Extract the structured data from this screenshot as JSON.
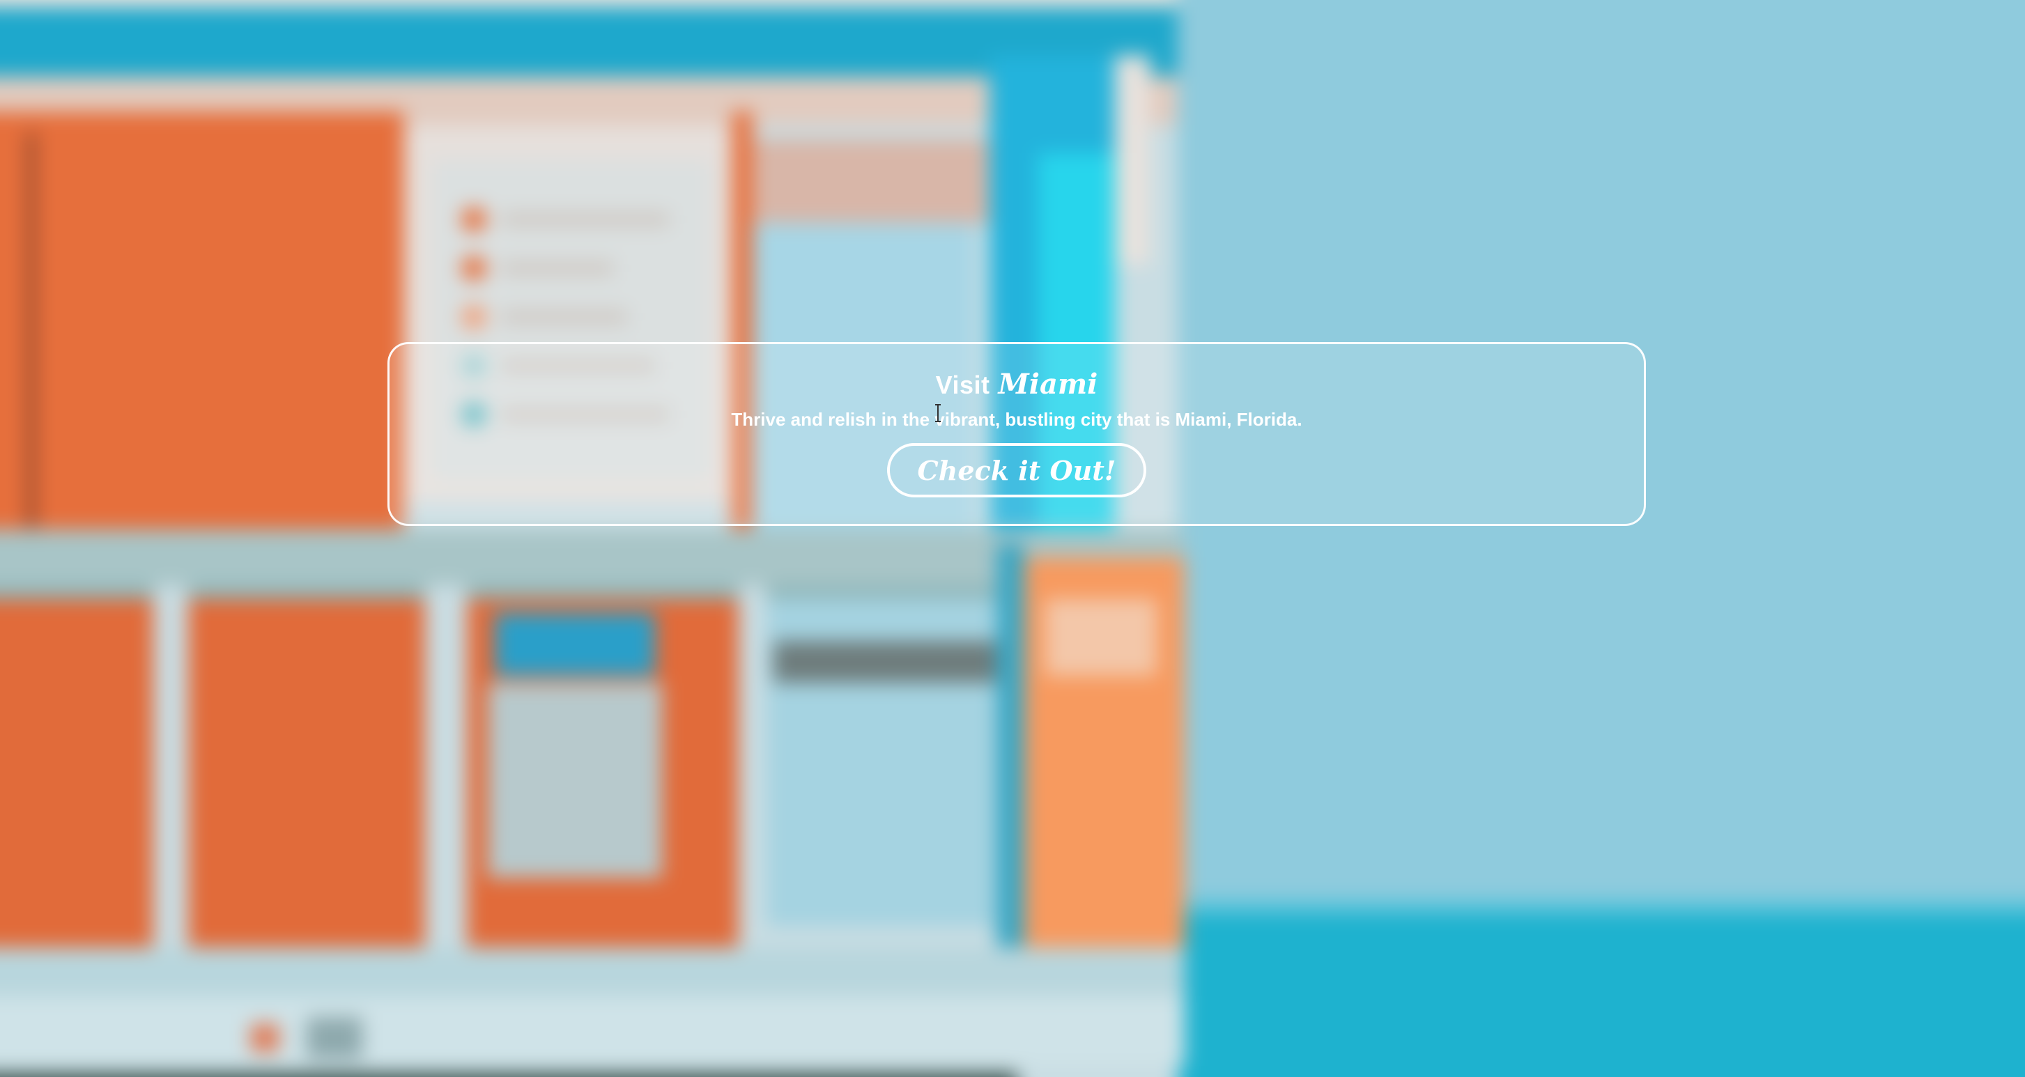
{
  "hero": {
    "title_prefix": "Visit",
    "title_accent": "Miami",
    "tagline": "Thrive and relish in the vibrant, bustling city that is Miami, Florida.",
    "cta_label": "Check it Out!"
  },
  "colors": {
    "sky": "#8fcde0",
    "sea": "#1fb0cc",
    "hut_orange": "#e8713e",
    "hut_teal": "#2fb6d6",
    "text": "#ffffff"
  },
  "icons": {
    "cursor": "text-cursor-icon"
  }
}
